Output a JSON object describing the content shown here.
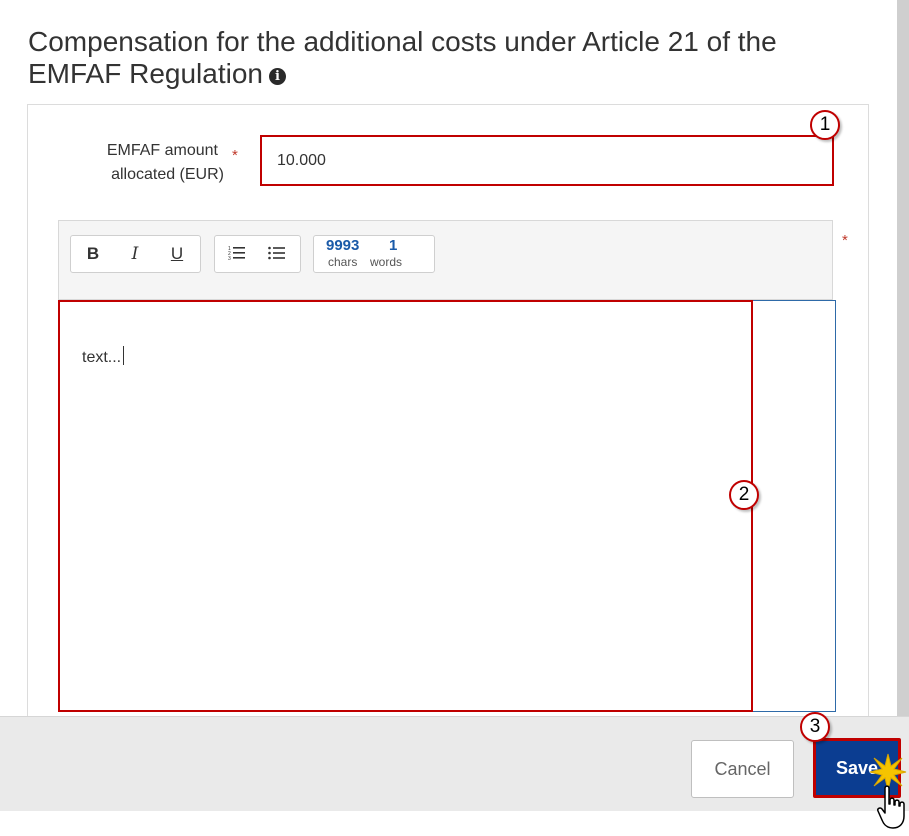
{
  "dialog": {
    "title": "Compensation for the additional costs under Article 21 of the EMFAF Regulation"
  },
  "amount_field": {
    "label_line1": "EMFAF amount",
    "label_line2": "allocated (EUR)",
    "value": "10.000",
    "required_marker": "*"
  },
  "editor": {
    "required_marker": "*",
    "toolbar": {
      "bold_label": "B",
      "italic_label": "I",
      "underline_label": "U",
      "numbered_list_icon": "numbered-list-icon",
      "bullet_list_icon": "bullet-list-icon",
      "chars_count": "9993",
      "chars_label": "chars",
      "words_count": "1",
      "words_label": "words"
    },
    "content": "text..."
  },
  "callouts": {
    "one": "1",
    "two": "2",
    "three": "3"
  },
  "footer": {
    "cancel_label": "Cancel",
    "save_label": "Save"
  },
  "colors": {
    "highlight_red": "#c00000",
    "save_blue": "#0b3d91",
    "counter_blue": "#1a5aa8",
    "editor_border": "#2e6aa8"
  }
}
